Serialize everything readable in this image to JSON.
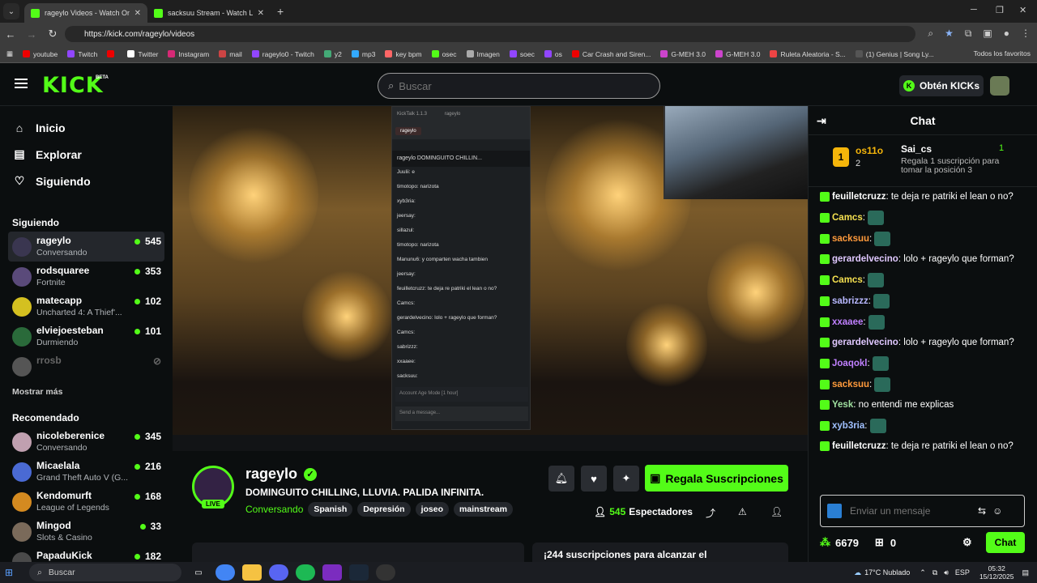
{
  "browser": {
    "tabs": [
      {
        "title": "rageylo Videos - Watch On",
        "active": true
      },
      {
        "title": "sacksuu Stream - Watch Live on",
        "active": false
      }
    ],
    "url": "https://kick.com/rageylo/videos",
    "bookmarks": [
      "youtube",
      "Twitch",
      "Twitter",
      "Instagram",
      "mail",
      "rageylo0 - Twitch",
      "y2",
      "mp3",
      "key bpm",
      "osec",
      "Imagen",
      "soec",
      "os",
      "Car Crash and Siren...",
      "G-MEH 3.0",
      "G-MEH 3.0",
      "Ruleta Aleatoria - S...",
      "(1) Genius | Song Ly..."
    ],
    "bookmarks_all": "Todos los favoritos",
    "win_controls": [
      "─",
      "❐",
      "✕"
    ]
  },
  "header": {
    "logo": "KICK",
    "beta": "BETA",
    "search_placeholder": "Buscar",
    "get_kicks": "Obtén KICKs"
  },
  "sidebar": {
    "nav": [
      {
        "label": "Inicio",
        "icon": "home-icon"
      },
      {
        "label": "Explorar",
        "icon": "browse-icon"
      },
      {
        "label": "Siguiendo",
        "icon": "heart-icon"
      }
    ],
    "following_title": "Siguiendo",
    "following": [
      {
        "name": "rageylo",
        "game": "Conversando",
        "viewers": "545",
        "color": "#3a3650"
      },
      {
        "name": "rodsquaree",
        "game": "Fortnite",
        "viewers": "353",
        "color": "#5a4a7a"
      },
      {
        "name": "matecapp",
        "game": "Uncharted 4: A Thief'...",
        "viewers": "102",
        "color": "#d4c020"
      },
      {
        "name": "elviejoesteban",
        "game": "Durmiendo",
        "viewers": "101",
        "color": "#2a6a3a"
      },
      {
        "name": "rrosb",
        "game": "",
        "viewers": "",
        "color": "#555",
        "offline": true
      }
    ],
    "show_more": "Mostrar más",
    "recommended_title": "Recomendado",
    "recommended": [
      {
        "name": "nicoleberenice",
        "game": "Conversando",
        "viewers": "345",
        "color": "#c0a0b0"
      },
      {
        "name": "Micaelala",
        "game": "Grand Theft Auto V (G...",
        "viewers": "216",
        "color": "#4a6ad4"
      },
      {
        "name": "Kendomurft",
        "game": "League of Legends",
        "viewers": "168",
        "color": "#d48a20"
      },
      {
        "name": "Mingod",
        "game": "Slots & Casino",
        "viewers": "33",
        "color": "#7a6a5a"
      },
      {
        "name": "PapaduKick",
        "game": "",
        "viewers": "182",
        "color": "#4a4a4a"
      }
    ]
  },
  "kicktalk": {
    "header": "KickTalk 1.1.3",
    "header_user": "rageylo",
    "tab": "rageylo",
    "title": "rageylo   DOMINGUITO CHILLIN...",
    "lines": [
      "Juulii: e",
      "timotopo: narizota",
      "xyb3ria:",
      "jeersay:",
      "sillazul:",
      "timotopo: narizota",
      "Manunu6: y comparten wacha tambien",
      "jeersay:",
      "feuilletcruzz: te deja re patriki el lean o no?",
      "Camcs:",
      "gerardelvecino: lolo + rageylo que forman?",
      "Camcs:",
      "sabrizzz:",
      "xxaaee:",
      "sacksuu:"
    ],
    "input": "Send a message...",
    "mode": "Account Age Mode [1 hour]"
  },
  "stream": {
    "name": "rageylo",
    "live": "LIVE",
    "title": "DOMINGUITO CHILLING, LLUVIA. PALIDA INFINITA.",
    "category": "Conversando",
    "tags": [
      "Spanish",
      "Depresión",
      "joseo",
      "mainstream"
    ],
    "gift_button": "Regala Suscripciones",
    "viewers": "545",
    "viewers_label": "Espectadores",
    "bottom_text": "¡244 suscripciones para alcanzar el"
  },
  "chat": {
    "title": "Chat",
    "pinned": {
      "rank": "1",
      "user1": "os11o",
      "count1": "2",
      "user2": "Sai_cs",
      "count2": "1",
      "desc": "Regala 1 suscripción para tomar la posición 3"
    },
    "messages": [
      {
        "user": "feuilletcruzz",
        "color": "#ffffff",
        "text": "te deja re patriki el lean o no?"
      },
      {
        "user": "Camcs",
        "color": "#f5e050",
        "text": ""
      },
      {
        "user": "sacksuu",
        "color": "#ff9a3c",
        "text": ""
      },
      {
        "user": "gerardelvecino",
        "color": "#e0c8ff",
        "text": "lolo + rageylo que forman?"
      },
      {
        "user": "Camcs",
        "color": "#f5e050",
        "text": ""
      },
      {
        "user": "sabrizzz",
        "color": "#b8b8ff",
        "text": ""
      },
      {
        "user": "xxaaee",
        "color": "#c080ff",
        "text": ""
      },
      {
        "user": "gerardelvecino",
        "color": "#e0c8ff",
        "text": "lolo + rageylo que forman?"
      },
      {
        "user": "Joaqokl",
        "color": "#c080ff",
        "text": ""
      },
      {
        "user": "sacksuu",
        "color": "#ff9a3c",
        "text": ""
      },
      {
        "user": "Yesk",
        "color": "#a0e0a0",
        "text": "no entendi me explicas"
      },
      {
        "user": "xyb3ria",
        "color": "#a0c0ff",
        "text": ""
      },
      {
        "user": "feuilletcruzz",
        "color": "#ffffff",
        "text": "te deja re patriki el lean o no?"
      }
    ],
    "input_placeholder": "Enviar un mensaje",
    "points": "6679",
    "gifts": "0",
    "send": "Chat"
  },
  "taskbar": {
    "search": "Buscar",
    "weather": "17°C  Nublado",
    "lang": "ESP",
    "time": "05:32",
    "date": "15/12/2025"
  },
  "colors": {
    "accent": "#53fc18",
    "bg": "#0b0e0f"
  }
}
